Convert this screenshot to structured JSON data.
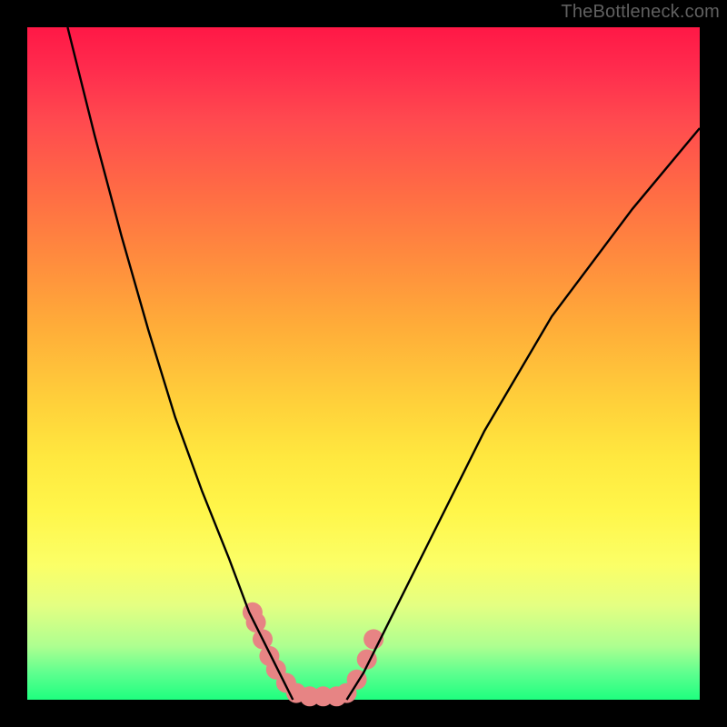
{
  "watermark": "TheBottleneck.com",
  "chart_data": {
    "type": "line",
    "title": "",
    "xlabel": "",
    "ylabel": "",
    "xlim": [
      0,
      100
    ],
    "ylim": [
      0,
      100
    ],
    "series": [
      {
        "name": "left-curve",
        "x": [
          6,
          10,
          14,
          18,
          22,
          26,
          30,
          33,
          36,
          38,
          39.5
        ],
        "values": [
          100,
          84,
          69,
          55,
          42,
          31,
          21,
          13,
          7,
          3,
          0
        ]
      },
      {
        "name": "right-curve",
        "x": [
          47.5,
          50,
          54,
          60,
          68,
          78,
          90,
          100
        ],
        "values": [
          0,
          4,
          12,
          24,
          40,
          57,
          73,
          85
        ]
      },
      {
        "name": "bottom-beads",
        "x": [
          33.5,
          34,
          35,
          36,
          37,
          38.5,
          40,
          42,
          44,
          46,
          47.5,
          49,
          50.5,
          51.5
        ],
        "values": [
          13,
          11.5,
          9,
          6.5,
          4.5,
          2.5,
          1,
          0.5,
          0.5,
          0.5,
          1,
          3,
          6,
          9
        ]
      }
    ],
    "bead_color": "#e78484",
    "bead_radius": 11,
    "description": "V-shaped bottleneck curve on rainbow gradient background"
  }
}
